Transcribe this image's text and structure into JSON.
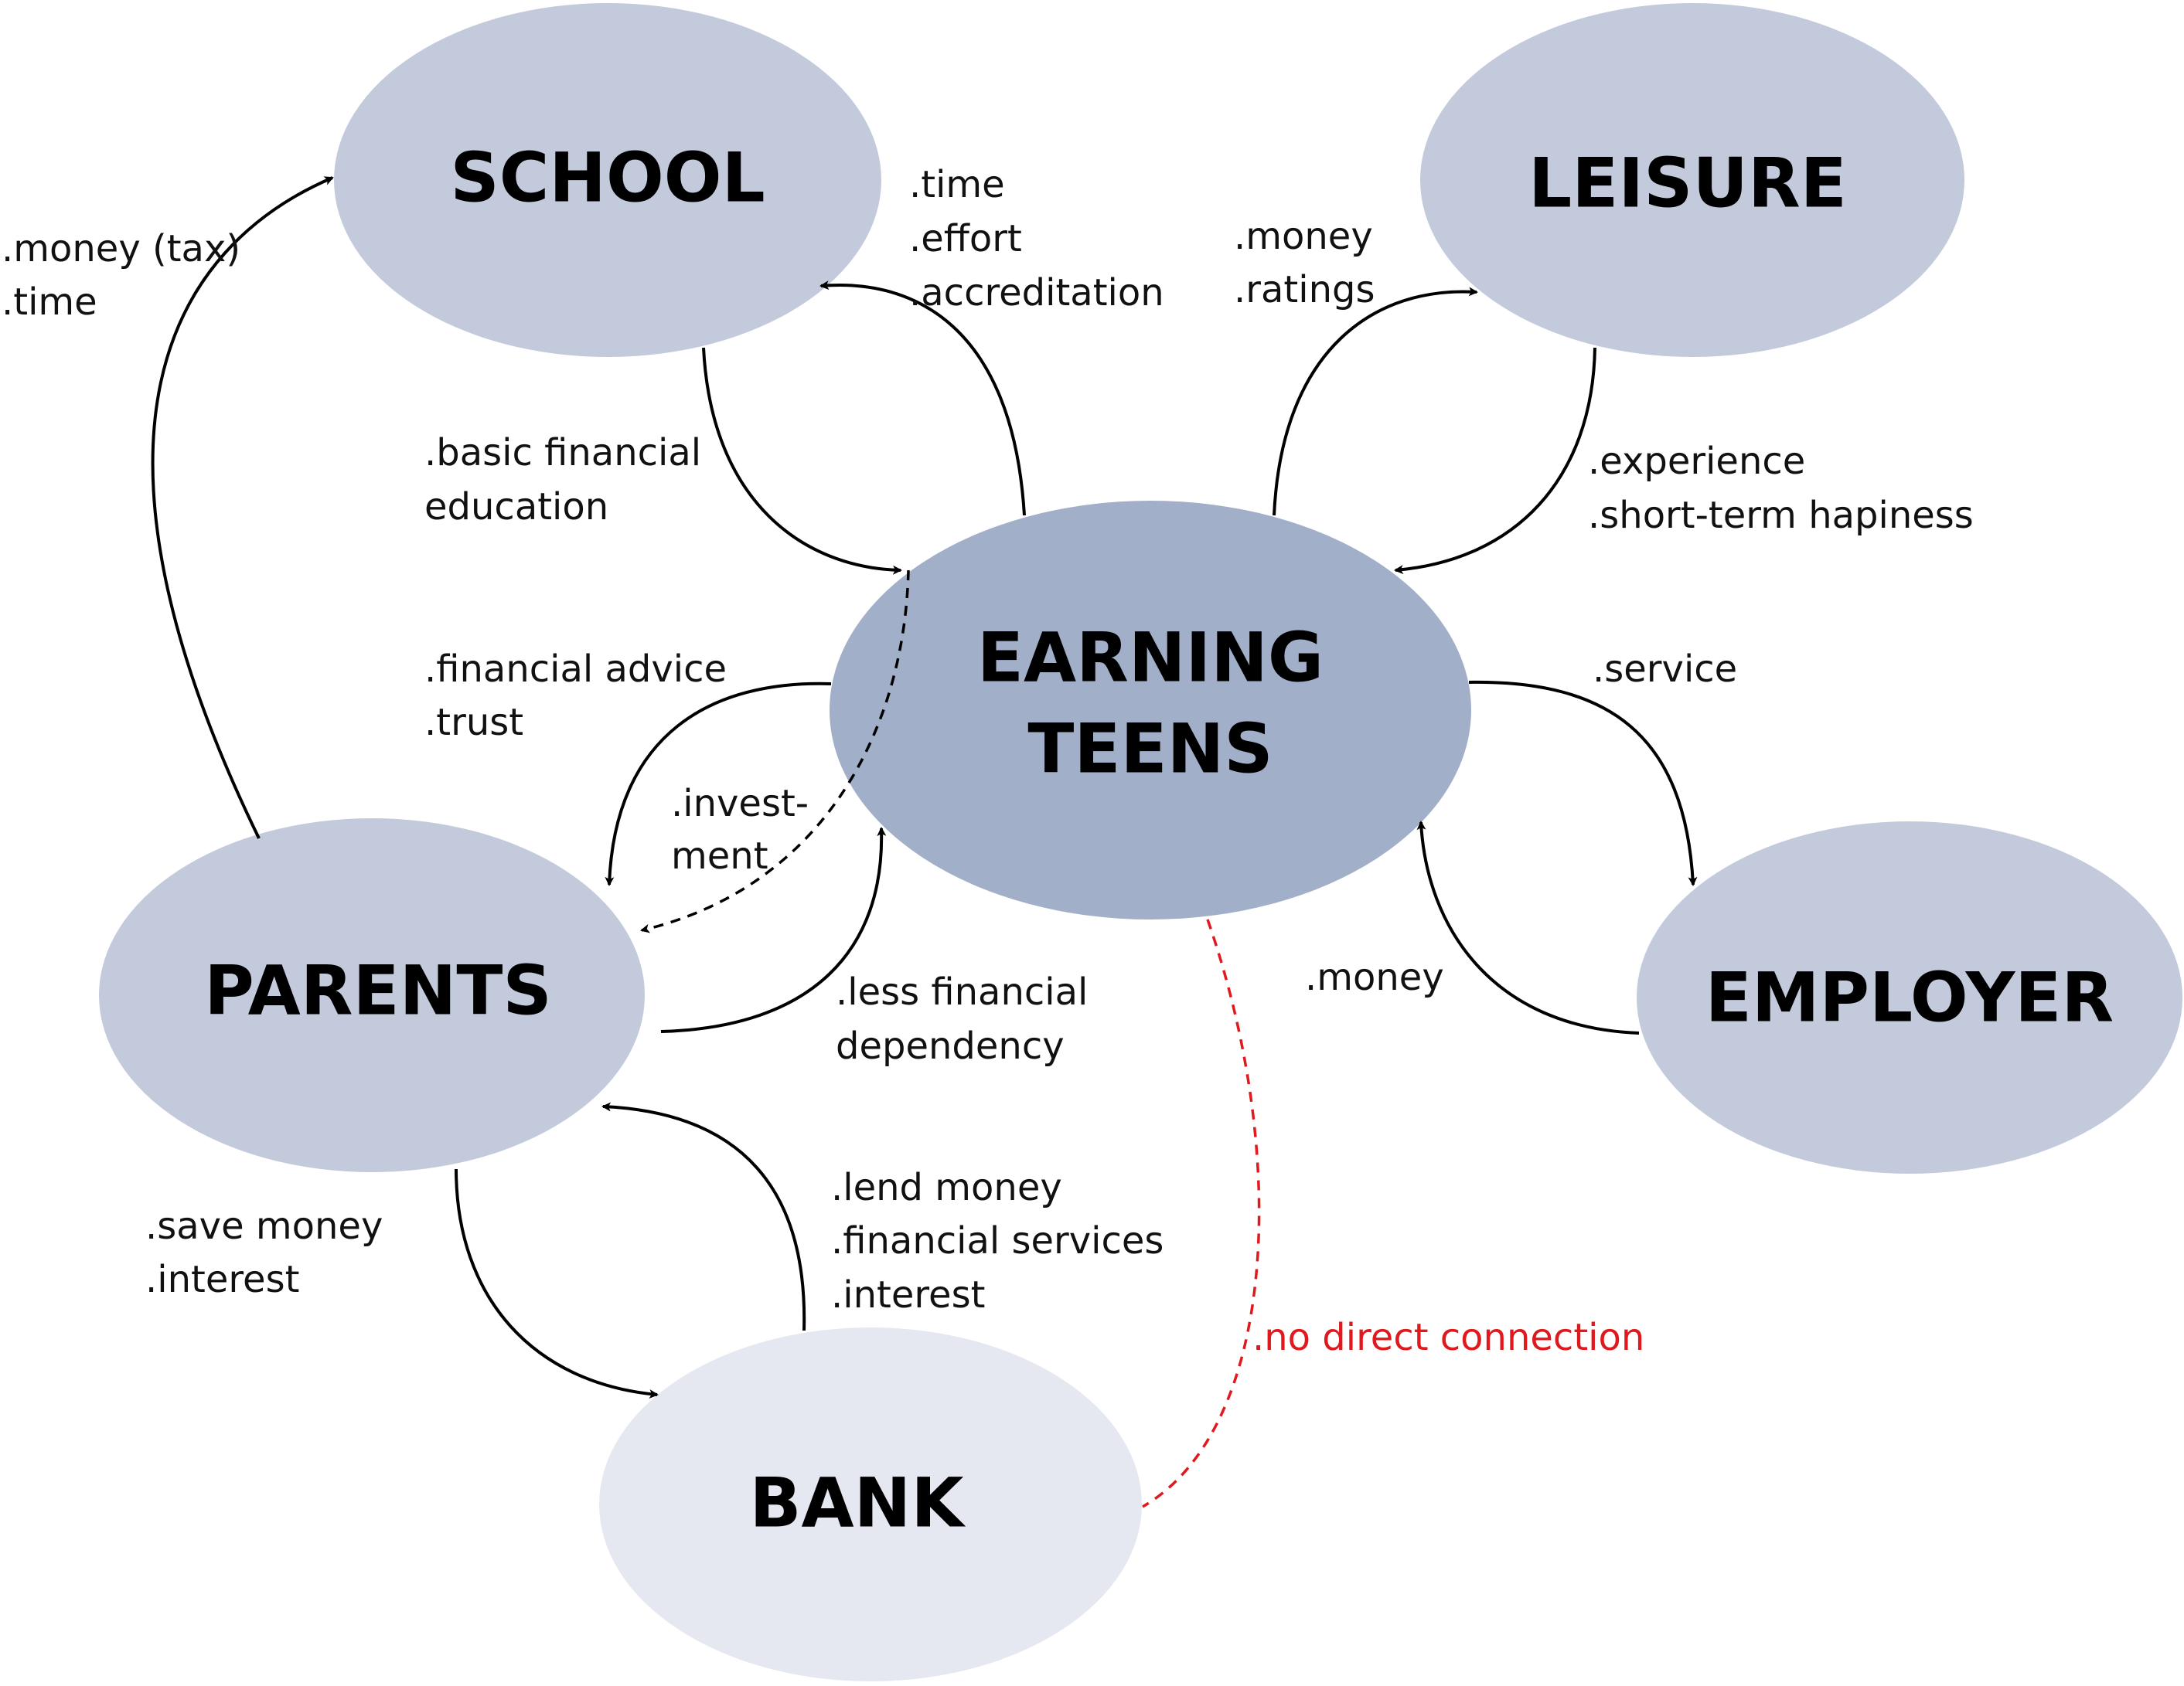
{
  "nodes": {
    "school": {
      "label": "SCHOOL",
      "fill": "#c2cadb"
    },
    "leisure": {
      "label": "LEISURE",
      "fill": "#c2cadb"
    },
    "earning": {
      "line1": "EARNING",
      "line2": "TEENS",
      "fill": "#a1afc9"
    },
    "parents": {
      "label": "PARENTS",
      "fill": "#c2cadb"
    },
    "employer": {
      "label": "EMPLOYER",
      "fill": "#c2cadb"
    },
    "bank": {
      "label": "BANK",
      "fill": "#e5e8f0"
    }
  },
  "edges": {
    "parents_to_school": [
      ".money (tax)",
      ".time"
    ],
    "teens_to_school": [
      ".time",
      ".effort",
      ".accreditation"
    ],
    "school_to_teens": [
      ".basic financial",
      "education"
    ],
    "teens_to_leisure": [
      ".money",
      ".ratings"
    ],
    "leisure_to_teens": [
      ".experience",
      ".short-term hapiness"
    ],
    "parents_advice": [
      ".financial advice",
      ".trust"
    ],
    "investment": [
      ".invest-",
      "ment"
    ],
    "teens_to_employer": [
      ".service"
    ],
    "employer_to_teens": [
      ".money"
    ],
    "teens_to_parents": [
      ".less financial",
      "dependency"
    ],
    "bank_to_parents": [
      ".lend money",
      ".financial services",
      ".interest"
    ],
    "parents_to_bank": [
      ".save money",
      ".interest"
    ],
    "no_connection": [
      ".no direct connection"
    ]
  },
  "colors": {
    "arrow": "#000000",
    "no_connection": "#e0191e"
  }
}
